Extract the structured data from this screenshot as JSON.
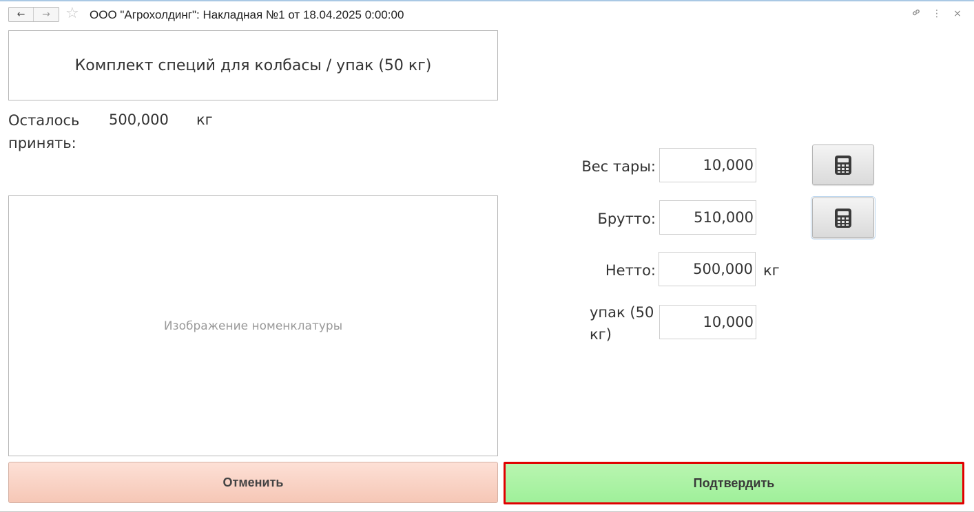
{
  "window": {
    "title": "ООО \"Агрохолдинг\": Накладная №1 от 18.04.2025 0:00:00",
    "back_icon": "arrow-left-icon",
    "forward_icon": "arrow-right-icon",
    "favorite_icon": "star-icon",
    "tools": [
      "link-icon",
      "more-vertical-icon",
      "close-icon"
    ]
  },
  "product": {
    "name": "Комплект специй для колбасы / упак (50 кг)",
    "image_placeholder": "Изображение номенклатуры"
  },
  "remaining": {
    "label": "Осталось принять:",
    "value": "500,000",
    "unit": "кг"
  },
  "form": {
    "tare_label": "Вес тары:",
    "tare_value": "10,000",
    "gross_label": "Брутто:",
    "gross_value": "510,000",
    "net_label": "Нетто:",
    "net_value": "500,000",
    "net_unit": "кг",
    "pack_label": "упак (50 кг)",
    "pack_value": "10,000",
    "calculator_icon": "calculator-icon"
  },
  "buttons": {
    "cancel": "Отменить",
    "confirm": "Подтвердить"
  },
  "colors": {
    "cancel_bg": "#f9d3c5",
    "confirm_bg": "#a8f3a3",
    "confirm_highlight_border": "#e00000"
  }
}
